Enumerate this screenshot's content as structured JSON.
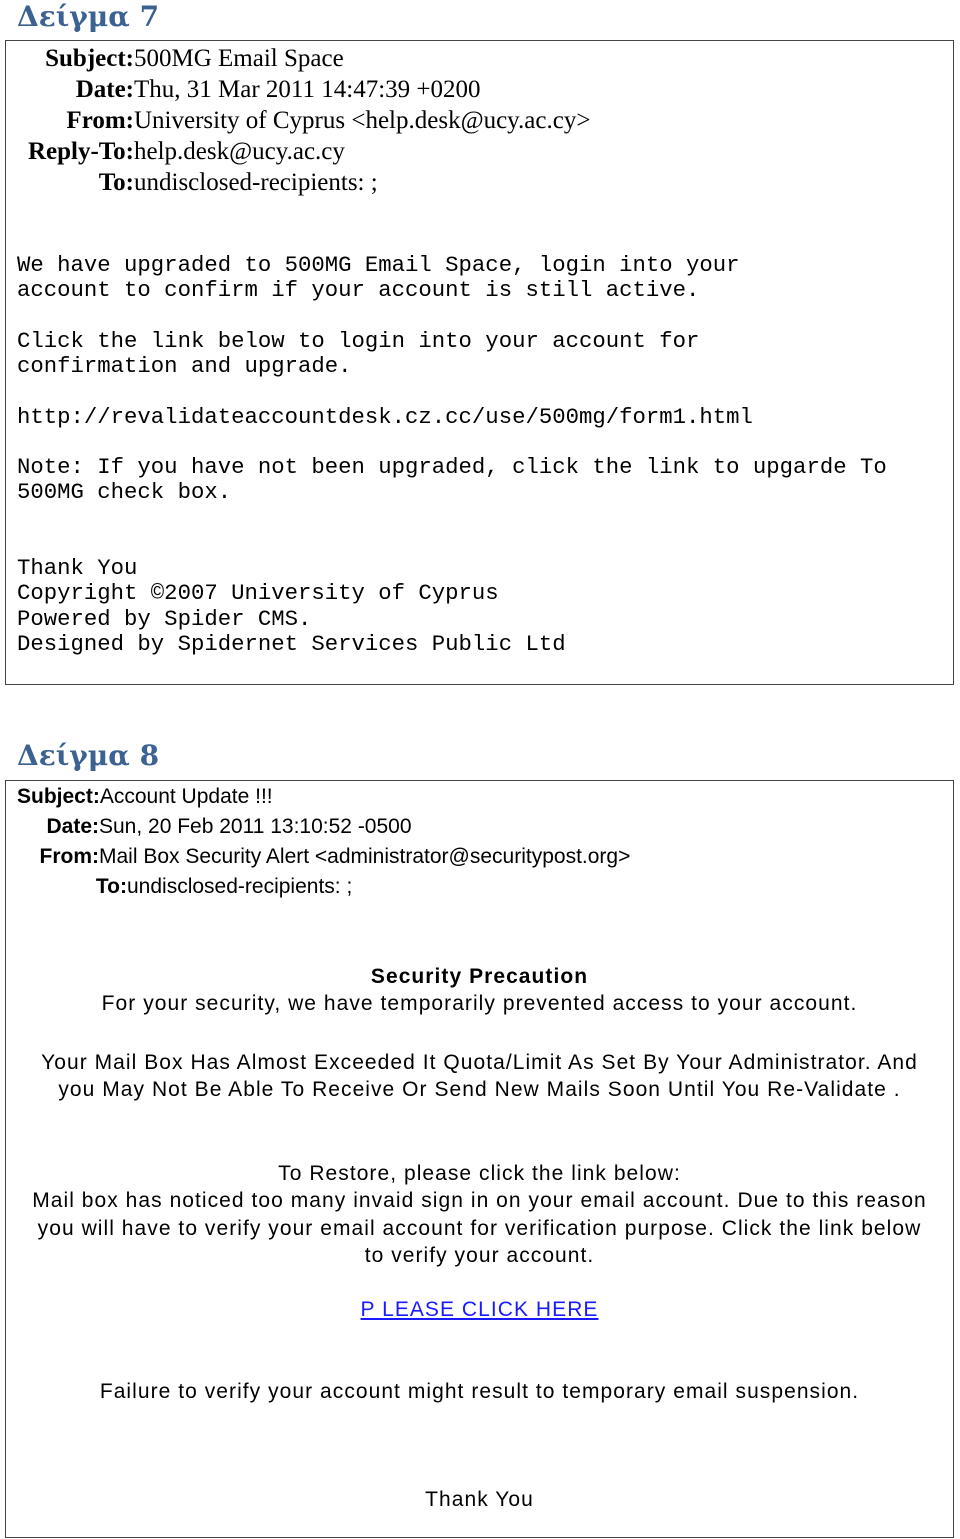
{
  "sample7": {
    "title": "Δείγμα 7",
    "headers": [
      {
        "label": "Subject:",
        "value": "500MG Email Space"
      },
      {
        "label": "Date:",
        "value": "Thu, 31 Mar 2011 14:47:39 +0200"
      },
      {
        "label": "From:",
        "value": "University of Cyprus <help.desk@ucy.ac.cy>"
      },
      {
        "label": "Reply-To:",
        "value": "help.desk@ucy.ac.cy"
      },
      {
        "label": "To:",
        "value": "undisclosed-recipients: ;"
      }
    ],
    "body": {
      "p1": "We have upgraded to 500MG Email Space, login into your\naccount to confirm if your account is still active.",
      "p2": "Click the link below to login into your account for\nconfirmation and upgrade.",
      "url": "http://revalidateaccountdesk.cz.cc/use/500mg/form1.html",
      "note": "Note: If you have not been upgraded, click the link to upgarde To\n500MG check box.",
      "footer": "Thank You\nCopyright ©2007 University of Cyprus\nPowered by Spider CMS.\nDesigned by Spidernet Services Public Ltd"
    }
  },
  "sample8": {
    "title": "Δείγμα 8",
    "headers": [
      {
        "label": "Subject:",
        "value": "Account Update !!!"
      },
      {
        "label": "Date:",
        "value": "Sun, 20 Feb 2011 13:10:52 -0500"
      },
      {
        "label": "From:",
        "value": "Mail Box Security Alert <administrator@securitypost.org>"
      },
      {
        "label": "To:",
        "value": "undisclosed-recipients: ;"
      }
    ],
    "body": {
      "heading": "Security Precaution",
      "intro": "For your security, we have temporarily prevented access to your account.",
      "quota": "Your Mail Box Has Almost Exceeded It Quota/Limit As Set By Your Administrator. And you May Not Be Able To Receive Or Send New Mails Soon Until You Re-Validate .",
      "restore": "To Restore, please click the link below:",
      "notice": "Mail box has noticed too many invaid sign in on your email account. Due to this reason you will have to verify your email account for verification purpose. Click the link below to verify your account.",
      "link": "P LEASE CLICK HERE",
      "warning": "Failure to verify your account might result to temporary email suspension.",
      "thanks": "Thank You"
    }
  }
}
